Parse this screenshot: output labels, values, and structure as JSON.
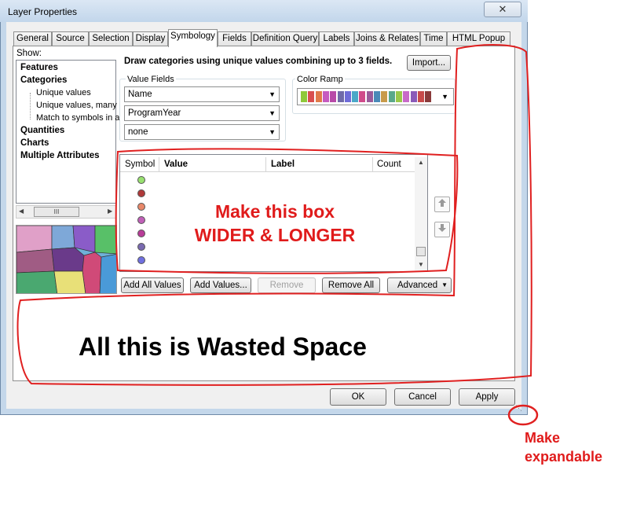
{
  "window": {
    "title": "Layer Properties",
    "close_icon": "x-icon"
  },
  "tabs": [
    {
      "label": "General"
    },
    {
      "label": "Source"
    },
    {
      "label": "Selection"
    },
    {
      "label": "Display"
    },
    {
      "label": "Symbology",
      "active": true
    },
    {
      "label": "Fields"
    },
    {
      "label": "Definition Query"
    },
    {
      "label": "Labels"
    },
    {
      "label": "Joins & Relates"
    },
    {
      "label": "Time"
    },
    {
      "label": "HTML Popup"
    }
  ],
  "show_panel": {
    "label": "Show:",
    "items": [
      {
        "label": "Features"
      },
      {
        "label": "Categories"
      },
      {
        "label": "Unique values"
      },
      {
        "label": "Unique values, many"
      },
      {
        "label": "Match to symbols in a"
      },
      {
        "label": "Quantities"
      },
      {
        "label": "Charts"
      },
      {
        "label": "Multiple Attributes"
      }
    ],
    "scroll_thumb": "III"
  },
  "symbology": {
    "description": "Draw categories using unique values combining up to 3 fields.",
    "import_label": "Import...",
    "value_fields_label": "Value Fields",
    "fields": [
      "Name",
      "ProgramYear",
      "none"
    ],
    "color_ramp_label": "Color Ramp",
    "color_ramp_colors": [
      "#8fc93a",
      "#d94f4f",
      "#e07a4a",
      "#c65bc0",
      "#b84aa8",
      "#6f6aa8",
      "#6f6cd8",
      "#4aa8c8",
      "#d04a8a",
      "#9a5a9a",
      "#4a8ab8",
      "#c89a4a",
      "#5aa88a",
      "#9ac84a",
      "#c86ac8",
      "#8a5ab8",
      "#c84a4a",
      "#8a3a3a"
    ],
    "table": {
      "headers": [
        "Symbol",
        "Value",
        "Label",
        "Count"
      ],
      "symbol_colors": [
        "#98e070",
        "#b03a3a",
        "#e8886a",
        "#c060b8",
        "#b83c98",
        "#7a6ab0",
        "#7070e0"
      ]
    },
    "move_up_icon": "arrow-up-icon",
    "move_down_icon": "arrow-down-icon",
    "buttons": {
      "add_all": "Add All Values",
      "add_values": "Add Values...",
      "remove": "Remove",
      "remove_all": "Remove All",
      "advanced": "Advanced"
    }
  },
  "dialog_buttons": {
    "ok": "OK",
    "cancel": "Cancel",
    "apply": "Apply"
  },
  "annotations": {
    "box_note_line1": "Make this box",
    "box_note_line2": "WIDER & LONGER",
    "wasted_space": "All this is Wasted Space",
    "expand_line1": "Make",
    "expand_line2": "expandable",
    "color": "#e01b1b"
  }
}
